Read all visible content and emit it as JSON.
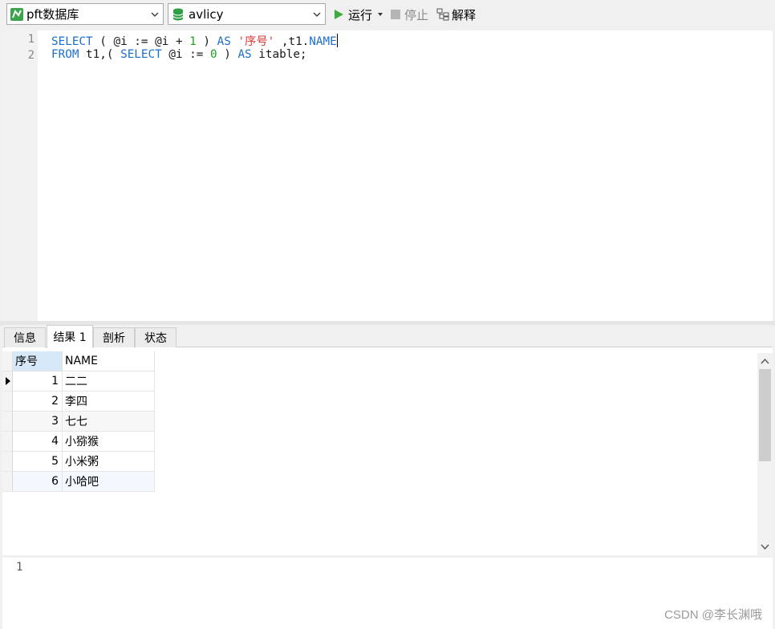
{
  "toolbar": {
    "connection": "pft数据库",
    "database": "avlicy",
    "run_label": "运行",
    "stop_label": "停止",
    "explain_label": "解释"
  },
  "editor": {
    "line_numbers": [
      "1",
      "2"
    ],
    "line1": {
      "t1": "SELECT",
      "t2": " ( @i := @i + ",
      "t3": "1",
      "t4": " ) ",
      "t5": "AS",
      "t6": " ",
      "t7": "'序号'",
      "t8": " ,t1.",
      "t9": "NAME"
    },
    "line2": {
      "t1": "FROM",
      "t2": " t1,( ",
      "t3": "SELECT",
      "t4": " @i := ",
      "t5": "0",
      "t6": " ) ",
      "t7": "AS",
      "t8": " itable;"
    }
  },
  "tabs": [
    {
      "label": "信息"
    },
    {
      "label": "结果 1"
    },
    {
      "label": "剖析"
    },
    {
      "label": "状态"
    }
  ],
  "grid": {
    "columns": [
      "序号",
      "NAME"
    ],
    "rows": [
      {
        "num": "1",
        "name": "二二"
      },
      {
        "num": "2",
        "name": "李四"
      },
      {
        "num": "3",
        "name": "七七"
      },
      {
        "num": "4",
        "name": "小猕猴"
      },
      {
        "num": "5",
        "name": "小米粥"
      },
      {
        "num": "6",
        "name": "小哈吧"
      }
    ]
  },
  "bottom": {
    "line_number": "1"
  },
  "watermark": "CSDN @李长渊哦",
  "colors": {
    "keyword": "#1c6fd0",
    "string": "#d93a3a",
    "number": "#20a020",
    "run_green": "#3aad3a"
  }
}
